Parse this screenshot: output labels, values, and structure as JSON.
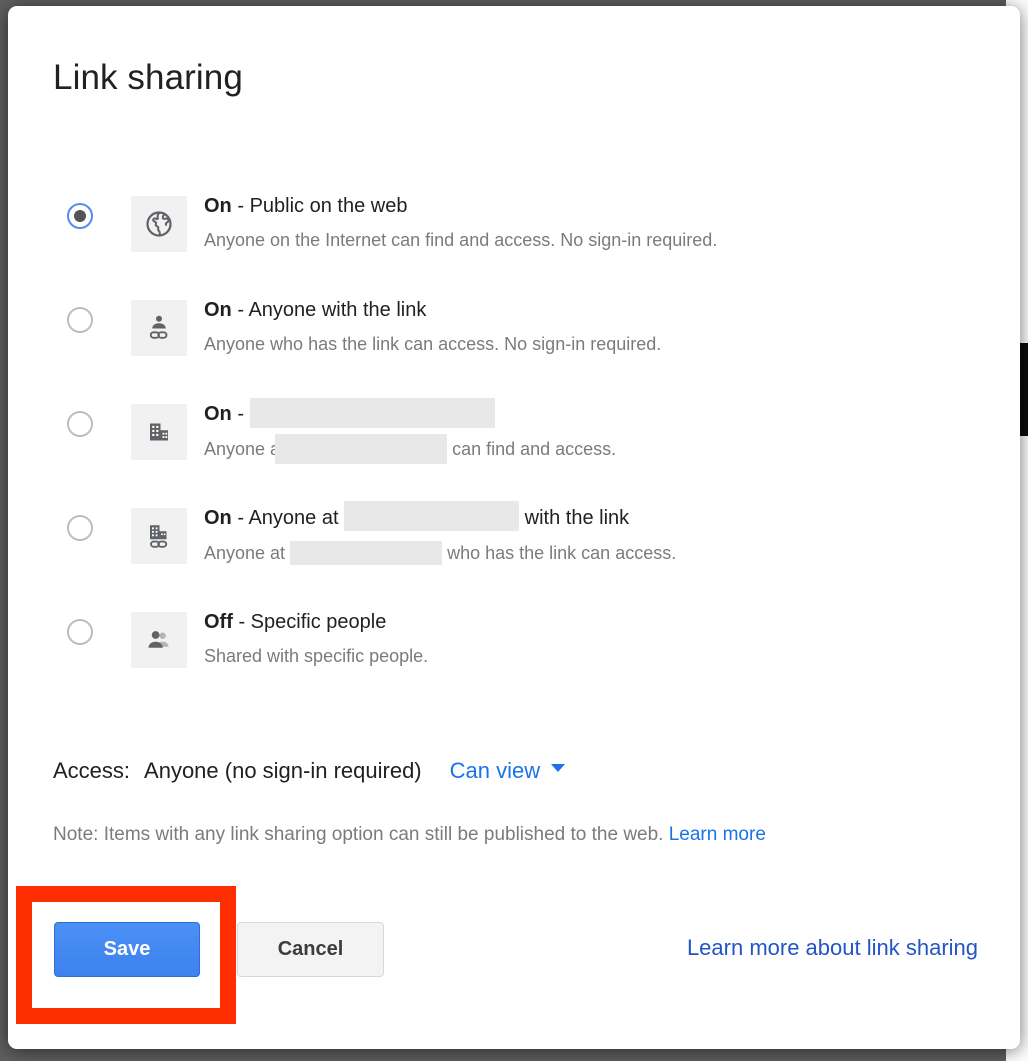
{
  "dialog": {
    "title": "Link sharing"
  },
  "options": [
    {
      "id": "public-on-the-web",
      "selected": true,
      "icon": "globe-icon",
      "state": "On",
      "separator": " - ",
      "title": "Public on the web",
      "desc": "Anyone on the Internet can find and access. No sign-in required.",
      "redacted_title": false,
      "redacted_desc": false
    },
    {
      "id": "anyone-with-the-link",
      "selected": false,
      "icon": "person-link-icon",
      "state": "On",
      "separator": " - ",
      "title": "Anyone with the link",
      "desc": "Anyone who has the link can access. No sign-in required.",
      "redacted_title": false,
      "redacted_desc": false
    },
    {
      "id": "organization-find-and-access",
      "selected": false,
      "icon": "building-icon",
      "state": "On",
      "separator": " - ",
      "title": "",
      "desc_before": "Anyone at",
      "desc_after": "can find and access.",
      "redacted_title": true,
      "redacted_desc": true
    },
    {
      "id": "organization-with-the-link",
      "selected": false,
      "icon": "building-link-icon",
      "state": "On",
      "separator": " - ",
      "title_before": "Anyone at",
      "title_after": "with the link",
      "desc_before": "Anyone at",
      "desc_after": "who has the link can access.",
      "redacted_title": true,
      "redacted_desc": true
    },
    {
      "id": "specific-people",
      "selected": false,
      "icon": "people-icon",
      "state": "Off",
      "separator": " - ",
      "title": "Specific people",
      "desc": "Shared with specific people.",
      "redacted_title": false,
      "redacted_desc": false
    }
  ],
  "access": {
    "label": "Access:",
    "value": "Anyone (no sign-in required)",
    "permission": "Can view",
    "caret_icon": "chevron-down-icon"
  },
  "note": {
    "text": "Note: Items with any link sharing option can still be published to the web.",
    "link": "Learn more"
  },
  "footer": {
    "save_label": "Save",
    "cancel_label": "Cancel",
    "help_link": "Learn more about link sharing"
  },
  "colors": {
    "accent_blue": "#4285f4",
    "link_blue": "#1a73e8",
    "footer_link_blue": "#2355c4",
    "highlight_red": "#ff2e00",
    "redaction_gray": "#e8e8e8",
    "icon_box_gray": "#f1f1f1",
    "muted_text": "#7b7b7b"
  }
}
